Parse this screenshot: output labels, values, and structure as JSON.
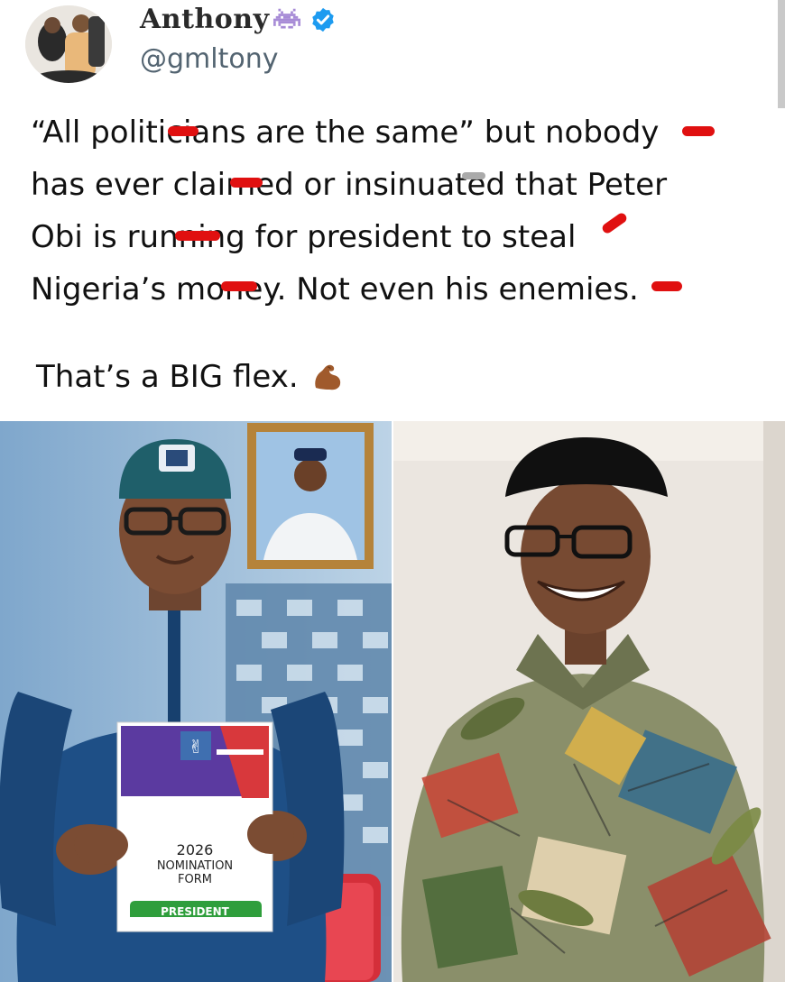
{
  "author": {
    "display_name": "Anthony",
    "handle": "@gmltony",
    "verified_color": "#1d9bf0"
  },
  "tweet": {
    "text": "“All politicians are the same” but nobody\nhas ever claimed or insinuated that Peter\nObi is running for president to steal\nNigeria’s money. Not even his enemies.",
    "flex_line": "That’s a BIG flex."
  },
  "icons": {
    "alien": "alien-monster-icon",
    "verified": "verified-badge-icon",
    "muscle": "flexed-biceps-icon"
  },
  "nomination_form": {
    "year": "2026",
    "line1": "NOMINATION",
    "line2": "FORM",
    "role": "PRESIDENT"
  },
  "colors": {
    "redaction": "#e01010",
    "handle": "#536471",
    "agbada_blue": "#1e4f86"
  }
}
